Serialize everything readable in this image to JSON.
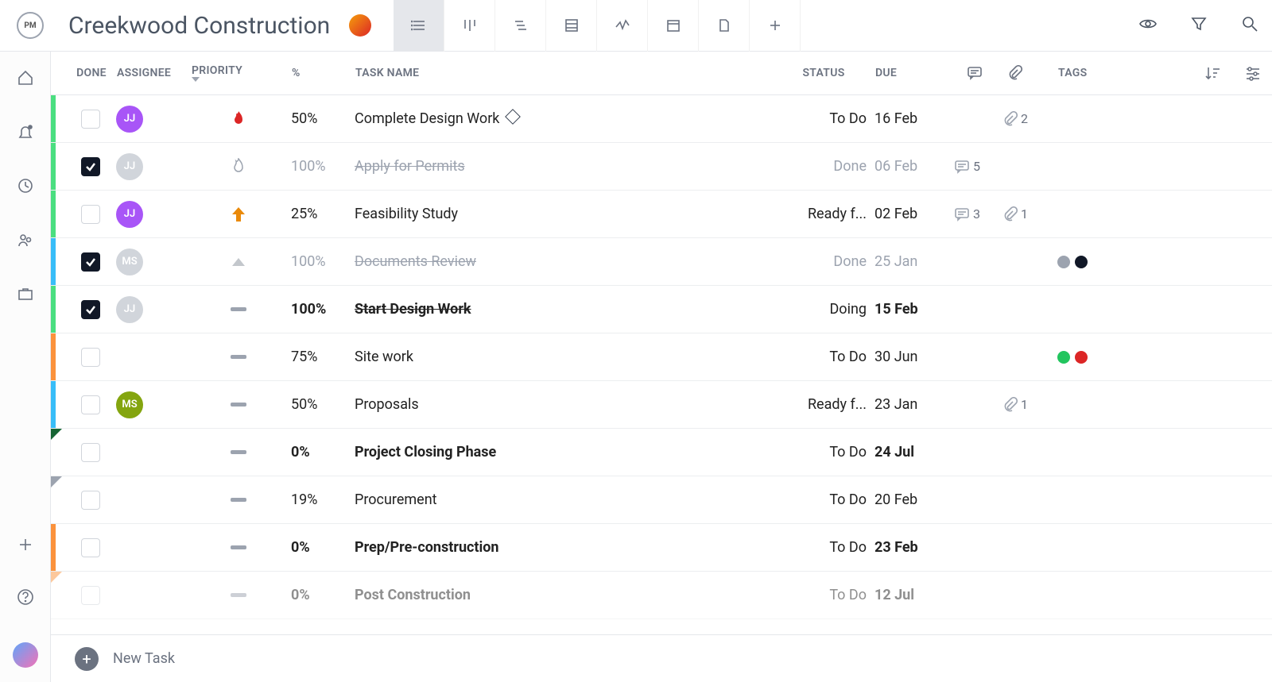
{
  "logo_text": "PM",
  "project_title": "Creekwood Construction",
  "columns": {
    "done": "DONE",
    "assignee": "ASSIGNEE",
    "priority": "PRIORITY",
    "percent": "%",
    "task": "TASK NAME",
    "status": "STATUS",
    "due": "DUE",
    "tags": "TAGS"
  },
  "footer_new_task": "New Task",
  "tasks": [
    {
      "bar": "#4ade80",
      "done": false,
      "assignee": {
        "initials": "JJ",
        "color": "#a855f7"
      },
      "priority": "flame-red",
      "percent": "50%",
      "name": "Complete Design Work",
      "milestone": true,
      "status": "To Do",
      "due": "16 Feb",
      "comments": null,
      "attach": "2",
      "tags": [],
      "bold": false
    },
    {
      "bar": "#4ade80",
      "done": true,
      "assignee": {
        "initials": "JJ",
        "color": "#d1d5db"
      },
      "priority": "flame-gray",
      "percent": "100%",
      "name": "Apply for Permits",
      "milestone": false,
      "status": "Done",
      "due": "06 Feb",
      "comments": "5",
      "attach": null,
      "tags": [],
      "bold": false,
      "donerow": true
    },
    {
      "bar": "#4ade80",
      "done": false,
      "assignee": {
        "initials": "JJ",
        "color": "#a855f7"
      },
      "priority": "arrow-orange",
      "percent": "25%",
      "name": "Feasibility Study",
      "milestone": false,
      "status": "Ready f...",
      "due": "02 Feb",
      "comments": "3",
      "attach": "1",
      "tags": [],
      "bold": false
    },
    {
      "bar": "#38bdf8",
      "done": true,
      "assignee": {
        "initials": "MS",
        "color": "#d1d5db"
      },
      "priority": "tri-gray",
      "percent": "100%",
      "name": "Documents Review",
      "milestone": false,
      "status": "Done",
      "due": "25 Jan",
      "comments": null,
      "attach": null,
      "tags": [
        "#9ca3af",
        "#111827"
      ],
      "bold": false,
      "donerow": true
    },
    {
      "bar": "#4ade80",
      "done": true,
      "assignee": {
        "initials": "JJ",
        "color": "#d1d5db"
      },
      "priority": "dash",
      "percent": "100%",
      "name": "Start Design Work",
      "milestone": false,
      "status": "Doing",
      "due": "15 Feb",
      "comments": null,
      "attach": null,
      "tags": [],
      "bold": true,
      "strike": true
    },
    {
      "bar": "#fb923c",
      "done": false,
      "assignee": null,
      "priority": "dash",
      "percent": "75%",
      "name": "Site work",
      "milestone": false,
      "status": "To Do",
      "due": "30 Jun",
      "comments": null,
      "attach": null,
      "tags": [
        "#22c55e",
        "#dc2626"
      ],
      "bold": false
    },
    {
      "bar": "#38bdf8",
      "done": false,
      "assignee": {
        "initials": "MS",
        "color": "#84a50f"
      },
      "priority": "dash",
      "percent": "50%",
      "name": "Proposals",
      "milestone": false,
      "status": "Ready f...",
      "due": "23 Jan",
      "comments": null,
      "attach": "1",
      "tags": [],
      "bold": false
    },
    {
      "bar": "tri:#166534",
      "done": false,
      "assignee": null,
      "priority": "dash",
      "percent": "0%",
      "name": "Project Closing Phase",
      "milestone": false,
      "status": "To Do",
      "due": "24 Jul",
      "comments": null,
      "attach": null,
      "tags": [],
      "bold": true
    },
    {
      "bar": "tri:#9ca3af",
      "done": false,
      "assignee": null,
      "priority": "dash",
      "percent": "19%",
      "name": "Procurement",
      "milestone": false,
      "status": "To Do",
      "due": "20 Feb",
      "comments": null,
      "attach": null,
      "tags": [],
      "bold": false
    },
    {
      "bar": "#fb923c",
      "done": false,
      "assignee": null,
      "priority": "dash",
      "percent": "0%",
      "name": "Prep/Pre-construction",
      "milestone": false,
      "status": "To Do",
      "due": "23 Feb",
      "comments": null,
      "attach": null,
      "tags": [],
      "bold": true
    },
    {
      "bar": "tri:#fb923c",
      "done": false,
      "assignee": null,
      "priority": "dash",
      "percent": "0%",
      "name": "Post Construction",
      "milestone": false,
      "status": "To Do",
      "due": "12 Jul",
      "comments": null,
      "attach": null,
      "tags": [],
      "bold": true,
      "fade": true
    }
  ]
}
